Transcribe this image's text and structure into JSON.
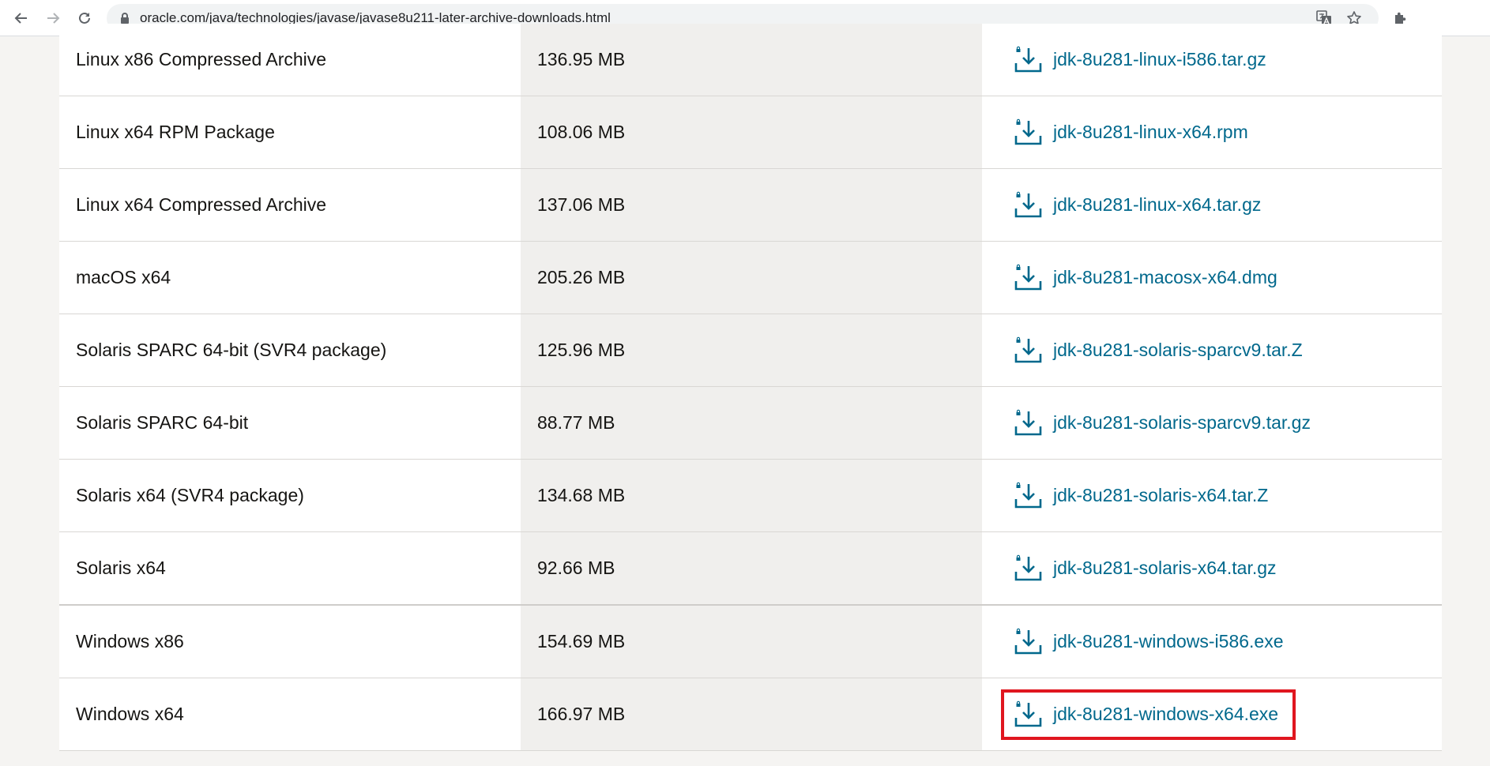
{
  "browser": {
    "url": "oracle.com/java/technologies/javase/javase8u211-later-archive-downloads.html",
    "icons": {
      "back": "arrow-left-icon",
      "forward": "arrow-right-icon",
      "reload": "reload-icon",
      "lock": "lock-icon",
      "translate": "translate-icon",
      "bookmark": "star-icon",
      "extensions": "puzzle-icon"
    }
  },
  "colors": {
    "link": "#00688c",
    "highlight": "#e0161f",
    "size_column_bg": "#f0efed"
  },
  "downloads": [
    {
      "product": "Linux x86 Compressed Archive",
      "size": "136.95 MB",
      "file": "jdk-8u281-linux-i586.tar.gz"
    },
    {
      "product": "Linux x64 RPM Package",
      "size": "108.06 MB",
      "file": "jdk-8u281-linux-x64.rpm"
    },
    {
      "product": "Linux x64 Compressed Archive",
      "size": "137.06 MB",
      "file": "jdk-8u281-linux-x64.tar.gz"
    },
    {
      "product": "macOS x64",
      "size": "205.26 MB",
      "file": "jdk-8u281-macosx-x64.dmg"
    },
    {
      "product": "Solaris SPARC 64-bit (SVR4 package)",
      "size": "125.96 MB",
      "file": "jdk-8u281-solaris-sparcv9.tar.Z"
    },
    {
      "product": "Solaris SPARC 64-bit",
      "size": "88.77 MB",
      "file": "jdk-8u281-solaris-sparcv9.tar.gz"
    },
    {
      "product": "Solaris x64 (SVR4 package)",
      "size": "134.68 MB",
      "file": "jdk-8u281-solaris-x64.tar.Z"
    },
    {
      "product": "Solaris x64",
      "size": "92.66 MB",
      "file": "jdk-8u281-solaris-x64.tar.gz"
    },
    {
      "product": "Windows x86",
      "size": "154.69 MB",
      "file": "jdk-8u281-windows-i586.exe"
    },
    {
      "product": "Windows x64",
      "size": "166.97 MB",
      "file": "jdk-8u281-windows-x64.exe"
    }
  ],
  "highlighted_file": "jdk-8u281-windows-x64.exe"
}
